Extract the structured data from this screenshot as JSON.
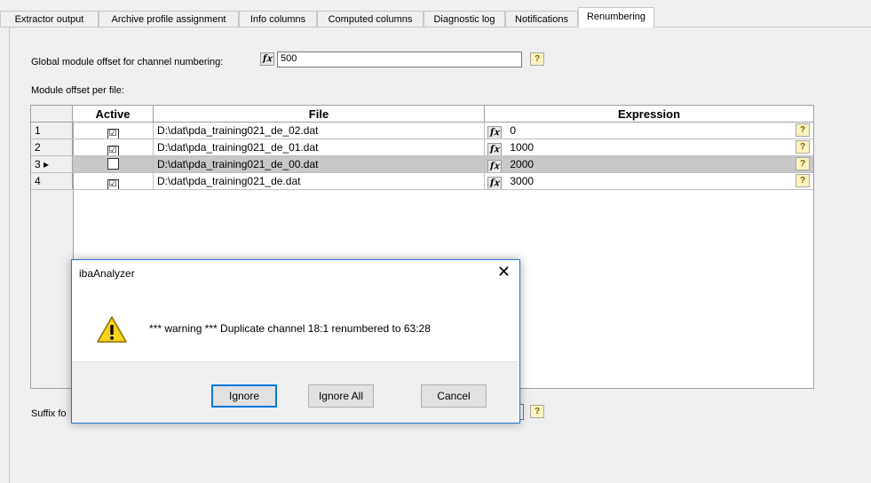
{
  "tabs": [
    {
      "label": "Extractor output"
    },
    {
      "label": "Archive profile assignment"
    },
    {
      "label": "Info columns"
    },
    {
      "label": "Computed columns"
    },
    {
      "label": "Diagnostic log"
    },
    {
      "label": "Notifications"
    },
    {
      "label": "Renumbering"
    }
  ],
  "renumbering": {
    "global_offset_label": "Global module offset for channel numbering:",
    "fx_icon": "f𝑥",
    "global_offset_value": "500",
    "help_icon": "?",
    "module_offset_label": "Module offset per file:",
    "suffix_label": "Suffix fo"
  },
  "grid": {
    "columns": {
      "active": "Active",
      "file": "File",
      "expression": "Expression"
    },
    "rows": [
      {
        "num": "1",
        "active": "☑",
        "file": "D:\\dat\\pda_training021_de_02.dat",
        "expression": "0"
      },
      {
        "num": "2",
        "active": "☑",
        "file": "D:\\dat\\pda_training021_de_01.dat",
        "expression": "1000"
      },
      {
        "num": "3 ▸",
        "active": "",
        "file": "D:\\dat\\pda_training021_de_00.dat",
        "expression": "2000"
      },
      {
        "num": "4",
        "active": "☑",
        "file": "D:\\dat\\pda_training021_de.dat",
        "expression": "3000"
      }
    ]
  },
  "dialog": {
    "title": "ibaAnalyzer",
    "close": "✕",
    "message": "*** warning *** Duplicate channel 18:1 renumbered to 63:28",
    "buttons": {
      "ignore": "Ignore",
      "ignore_all": "Ignore All",
      "cancel": "Cancel"
    }
  }
}
